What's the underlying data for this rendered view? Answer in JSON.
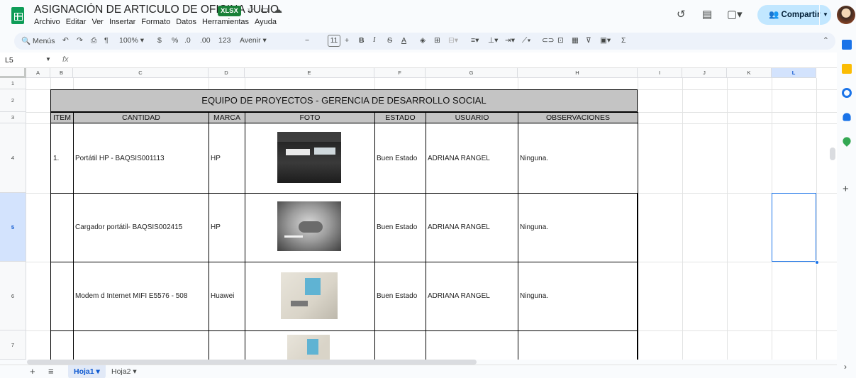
{
  "doc": {
    "title": "ASIGNACIÓN DE ARTICULO DE OFICINA JULIO",
    "extension": "XLSX",
    "share_label": "Compartir"
  },
  "menu": [
    "Archivo",
    "Editar",
    "Ver",
    "Insertar",
    "Formato",
    "Datos",
    "Herramientas",
    "Ayuda"
  ],
  "toolbar": {
    "menus_label": "Menús",
    "zoom": "100%",
    "currency": "$",
    "percent": "%",
    "dec_dec": ".0",
    "inc_dec": ".00",
    "num_format": "123",
    "font": "Avenir",
    "font_size": "11",
    "minus": "−",
    "plus": "+",
    "bold": "B",
    "italic": "I",
    "strike": "S",
    "text_color": "A"
  },
  "formula_bar": {
    "cell_ref": "L5",
    "fx": "fx"
  },
  "columns": [
    "A",
    "B",
    "C",
    "D",
    "E",
    "F",
    "G",
    "H",
    "I",
    "J",
    "K",
    "L"
  ],
  "rows": [
    "1",
    "2",
    "3",
    "4",
    "5",
    "6",
    "7"
  ],
  "selected_cell": "L5",
  "sheet": {
    "banner": "EQUIPO DE PROYECTOS - GERENCIA DE DESARROLLO SOCIAL",
    "headers": [
      "ITEM",
      "CANTIDAD",
      "MARCA",
      "FOTO",
      "ESTADO",
      "USUARIO",
      "OBSERVACIONES"
    ],
    "records": [
      {
        "item": "1.",
        "cantidad": "Portátil HP - BAQSIS001113",
        "marca": "HP",
        "estado": "Buen Estado",
        "usuario": "ADRIANA RANGEL",
        "observaciones": "Ninguna."
      },
      {
        "item": "",
        "cantidad": "Cargador portátil- BAQSIS002415",
        "marca": "HP",
        "estado": "Buen Estado",
        "usuario": "ADRIANA RANGEL",
        "observaciones": "Ninguna."
      },
      {
        "item": "",
        "cantidad": "Modem d Internet MIFI E5576 - 508",
        "marca": "Huawei",
        "estado": "Buen Estado",
        "usuario": "ADRIANA RANGEL",
        "observaciones": "Ninguna."
      }
    ]
  },
  "sheets": [
    {
      "name": "Hoja1",
      "active": true
    },
    {
      "name": "Hoja2",
      "active": false
    }
  ]
}
